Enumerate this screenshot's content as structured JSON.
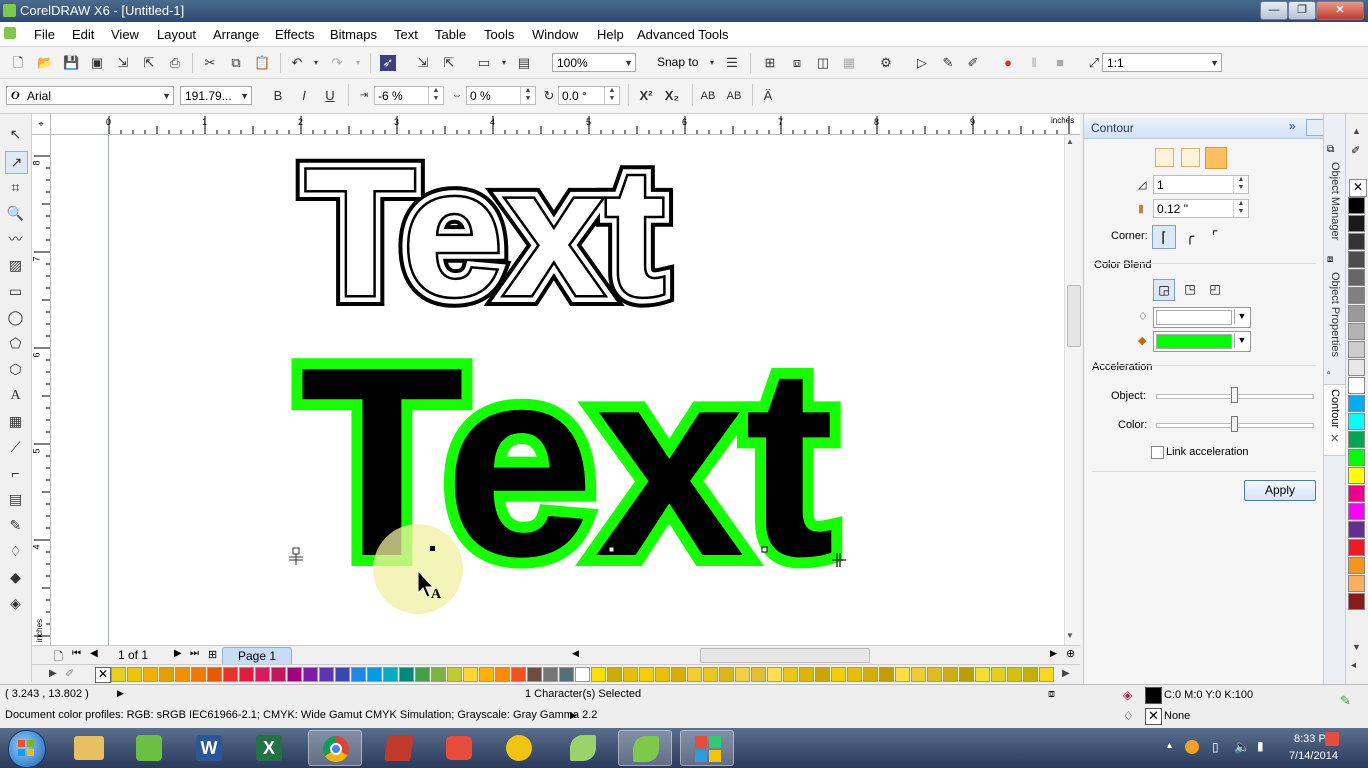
{
  "window": {
    "title": "CorelDRAW X6 - [Untitled-1]",
    "minimize": "—",
    "maximize": "❐",
    "close": "✕"
  },
  "menu": [
    "File",
    "Edit",
    "View",
    "Layout",
    "Arrange",
    "Effects",
    "Bitmaps",
    "Text",
    "Table",
    "Tools",
    "Window",
    "Help",
    "Advanced Tools"
  ],
  "toolbar": {
    "zoom": "100%",
    "snap_to": "Snap to",
    "page_zoom": "1:1"
  },
  "property_bar": {
    "font_name": "Arial",
    "font_size": "191.79...",
    "kerning": "-6 %",
    "char_spacing": "0 %",
    "angle": "0.0 °"
  },
  "ruler": {
    "units": "inches",
    "h_ticks": [
      "0",
      "1",
      "2",
      "3",
      "4",
      "5",
      "6",
      "7",
      "8",
      "9"
    ],
    "v_ticks": [
      "8",
      "7",
      "6",
      "5",
      "4"
    ],
    "v_units": "inches"
  },
  "canvas": {
    "text_top": "Text",
    "text_bottom": "Text",
    "cursor_glyph": "A"
  },
  "page_nav": {
    "counter": "1 of 1",
    "page_tab": "Page 1"
  },
  "docker": {
    "title": "Contour",
    "steps": "1",
    "offset": "0.12 \"",
    "corner_label": "Corner:",
    "color_blend_label": "Color Blend",
    "outline_color": "#ffffff",
    "fill_color": "#00ff00",
    "acceleration_label": "Acceleration",
    "object_label": "Object:",
    "color_label": "Color:",
    "object_accel": 0.5,
    "color_accel": 0.5,
    "link_accel_label": "Link acceleration",
    "apply_label": "Apply",
    "tabs": [
      "Object Manager",
      "Object Properties",
      "Contour"
    ]
  },
  "palette_colors": [
    "#000000",
    "#1a1a1a",
    "#333333",
    "#4d4d4d",
    "#666666",
    "#808080",
    "#999999",
    "#b3b3b3",
    "#cccccc",
    "#e6e6e6",
    "#ffffff",
    "#00aeef",
    "#00ffff",
    "#00a651",
    "#00ff00",
    "#ffff00",
    "#ec008c",
    "#ff00ff",
    "#662d91",
    "#ed1c24",
    "#f7941d",
    "#fbaf5d",
    "#8b1a1a"
  ],
  "hpalette_colors": [
    "#e8d020",
    "#e8c800",
    "#f0b000",
    "#e0a000",
    "#f29100",
    "#ee7a00",
    "#e85a00",
    "#e8322a",
    "#e01e3c",
    "#d81b60",
    "#c2185b",
    "#a00080",
    "#7b1fa2",
    "#5e35b1",
    "#3949ab",
    "#1e88e5",
    "#039be5",
    "#00acc1",
    "#00897b",
    "#43a047",
    "#7cb342",
    "#c0ca33",
    "#fdd835",
    "#ffb300",
    "#fb8c00",
    "#f4511e",
    "#6d4c41",
    "#757575",
    "#546e7a",
    "#ffffff",
    "#f8e000",
    "#c7b000",
    "#e0c000",
    "#f5d000",
    "#e6c200",
    "#d4b000",
    "#f0d030",
    "#e8c820",
    "#d8b818",
    "#f0d040",
    "#e0c030",
    "#f8e050",
    "#e8c810",
    "#d8b800",
    "#c8a800",
    "#f0d000",
    "#e0c000",
    "#d0b000",
    "#c0a000",
    "#f8e040",
    "#e8d030",
    "#d8c020",
    "#c8b010",
    "#b8a000",
    "#f0e030",
    "#e0d020",
    "#d0c010",
    "#c0b000",
    "#f8d820",
    "#e8c810",
    "#d8b800",
    "#c8a800",
    "#f0d000"
  ],
  "status": {
    "coords": "( 3.243 , 13.802 )",
    "selection": "1 Character(s) Selected",
    "fill_info": "C:0 M:0 Y:0 K:100",
    "outline_info": "None",
    "profiles": "Document color profiles: RGB: sRGB IEC61966-2.1; CMYK: Wide Gamut CMYK Simulation; Grayscale: Gray Gamma 2.2"
  },
  "tray": {
    "time": "8:33 PM",
    "date": "7/14/2014"
  }
}
